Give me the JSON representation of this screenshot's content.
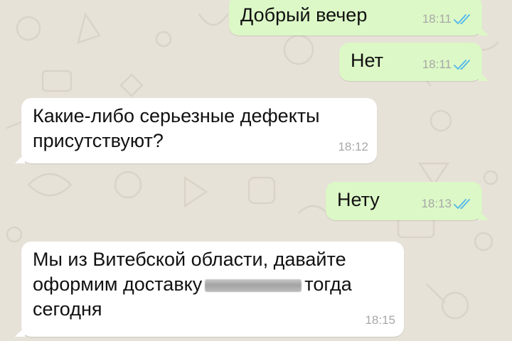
{
  "chat": {
    "messages": [
      {
        "direction": "outgoing",
        "text": "Добрый вечер",
        "time": "18:11",
        "status": "read"
      },
      {
        "direction": "outgoing",
        "text": "Нет",
        "time": "18:11",
        "status": "read"
      },
      {
        "direction": "incoming",
        "text": "Какие-либо серьезные дефекты\nприсутствуют?",
        "time": "18:12"
      },
      {
        "direction": "outgoing",
        "text": "Нету",
        "time": "18:13",
        "status": "read"
      },
      {
        "direction": "incoming",
        "line1": "Мы из Витебской области, давайте",
        "line2_before": "оформим доставку",
        "line2_after": "тогда",
        "line3": "сегодня",
        "time": "18:15"
      }
    ]
  },
  "colors": {
    "wallpaper": "#e7e2d8",
    "outgoing_bubble": "#dcf8c6",
    "incoming_bubble": "#ffffff",
    "read_ticks": "#4fb6ec",
    "timestamp": "#a8a8a8"
  },
  "icons": {
    "read_receipt": "double-check-icon"
  }
}
